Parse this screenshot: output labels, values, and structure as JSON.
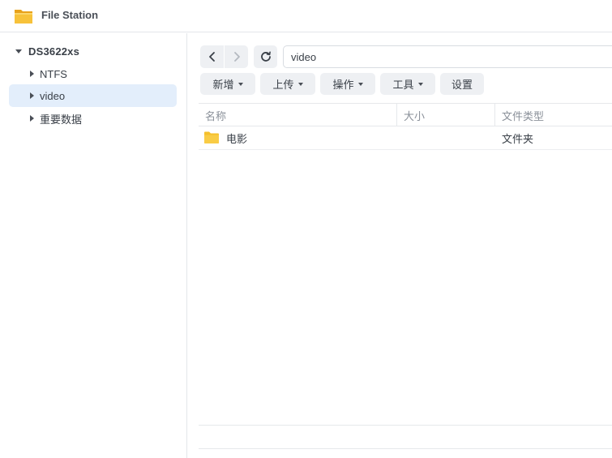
{
  "app": {
    "title": "File Station",
    "icon": "folder-app-icon"
  },
  "sidebar": {
    "root": {
      "label": "DS3622xs",
      "expanded": true
    },
    "items": [
      {
        "label": "NTFS",
        "selected": false
      },
      {
        "label": "video",
        "selected": true
      },
      {
        "label": "重要数据",
        "selected": false
      }
    ]
  },
  "nav": {
    "back_icon": "chevron-left-icon",
    "forward_icon": "chevron-right-icon",
    "refresh_icon": "refresh-icon",
    "path": "video"
  },
  "toolbar": {
    "create_label": "新增",
    "upload_label": "上传",
    "action_label": "操作",
    "tools_label": "工具",
    "settings_label": "设置"
  },
  "table": {
    "columns": [
      "名称",
      "大小",
      "文件类型"
    ],
    "rows": [
      {
        "name": "电影",
        "size": "",
        "type": "文件夹",
        "icon": "folder-icon"
      }
    ]
  },
  "colors": {
    "selected_bg": "#e3eefb",
    "button_bg": "#eef0f3",
    "folder": "#f5c02c"
  }
}
